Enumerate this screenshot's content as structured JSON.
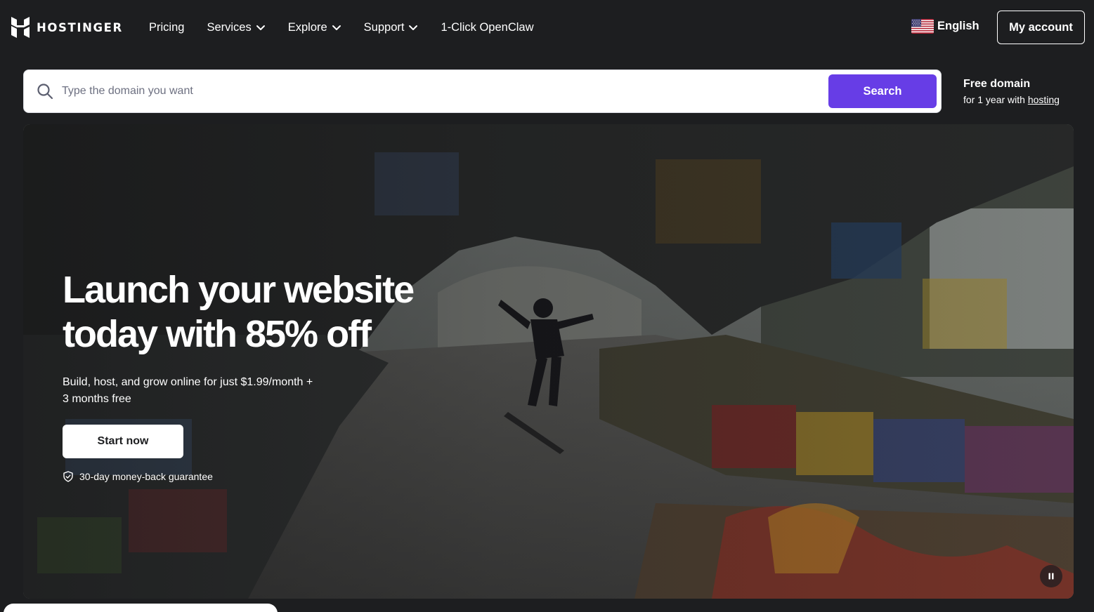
{
  "header": {
    "logo_text": "HOSTINGER",
    "nav": [
      {
        "label": "Pricing",
        "has_dropdown": false
      },
      {
        "label": "Services",
        "has_dropdown": true
      },
      {
        "label": "Explore",
        "has_dropdown": true
      },
      {
        "label": "Support",
        "has_dropdown": true
      },
      {
        "label": "1-Click OpenClaw",
        "has_dropdown": false
      }
    ],
    "language": "English",
    "language_icon": "us-flag-icon",
    "account_label": "My account"
  },
  "search": {
    "placeholder": "Type the domain you want",
    "value": "",
    "button_label": "Search",
    "icon": "search-icon"
  },
  "promo": {
    "title": "Free domain",
    "sub_prefix": "for 1 year with",
    "sub_link": "hosting"
  },
  "hero": {
    "title_line1": "Launch your website",
    "title_line2": "today with 85% off",
    "subtitle_line1": "Build, host, and grow online for just $1.99/month +",
    "subtitle_line2": "3 months free",
    "cta_label": "Start now",
    "guarantee": "30-day money-back guarantee",
    "guarantee_icon": "shield-check-icon",
    "pause_icon": "pause-icon"
  },
  "colors": {
    "page_bg": "#1d1e20",
    "primary": "#673de6",
    "text": "#ffffff"
  }
}
